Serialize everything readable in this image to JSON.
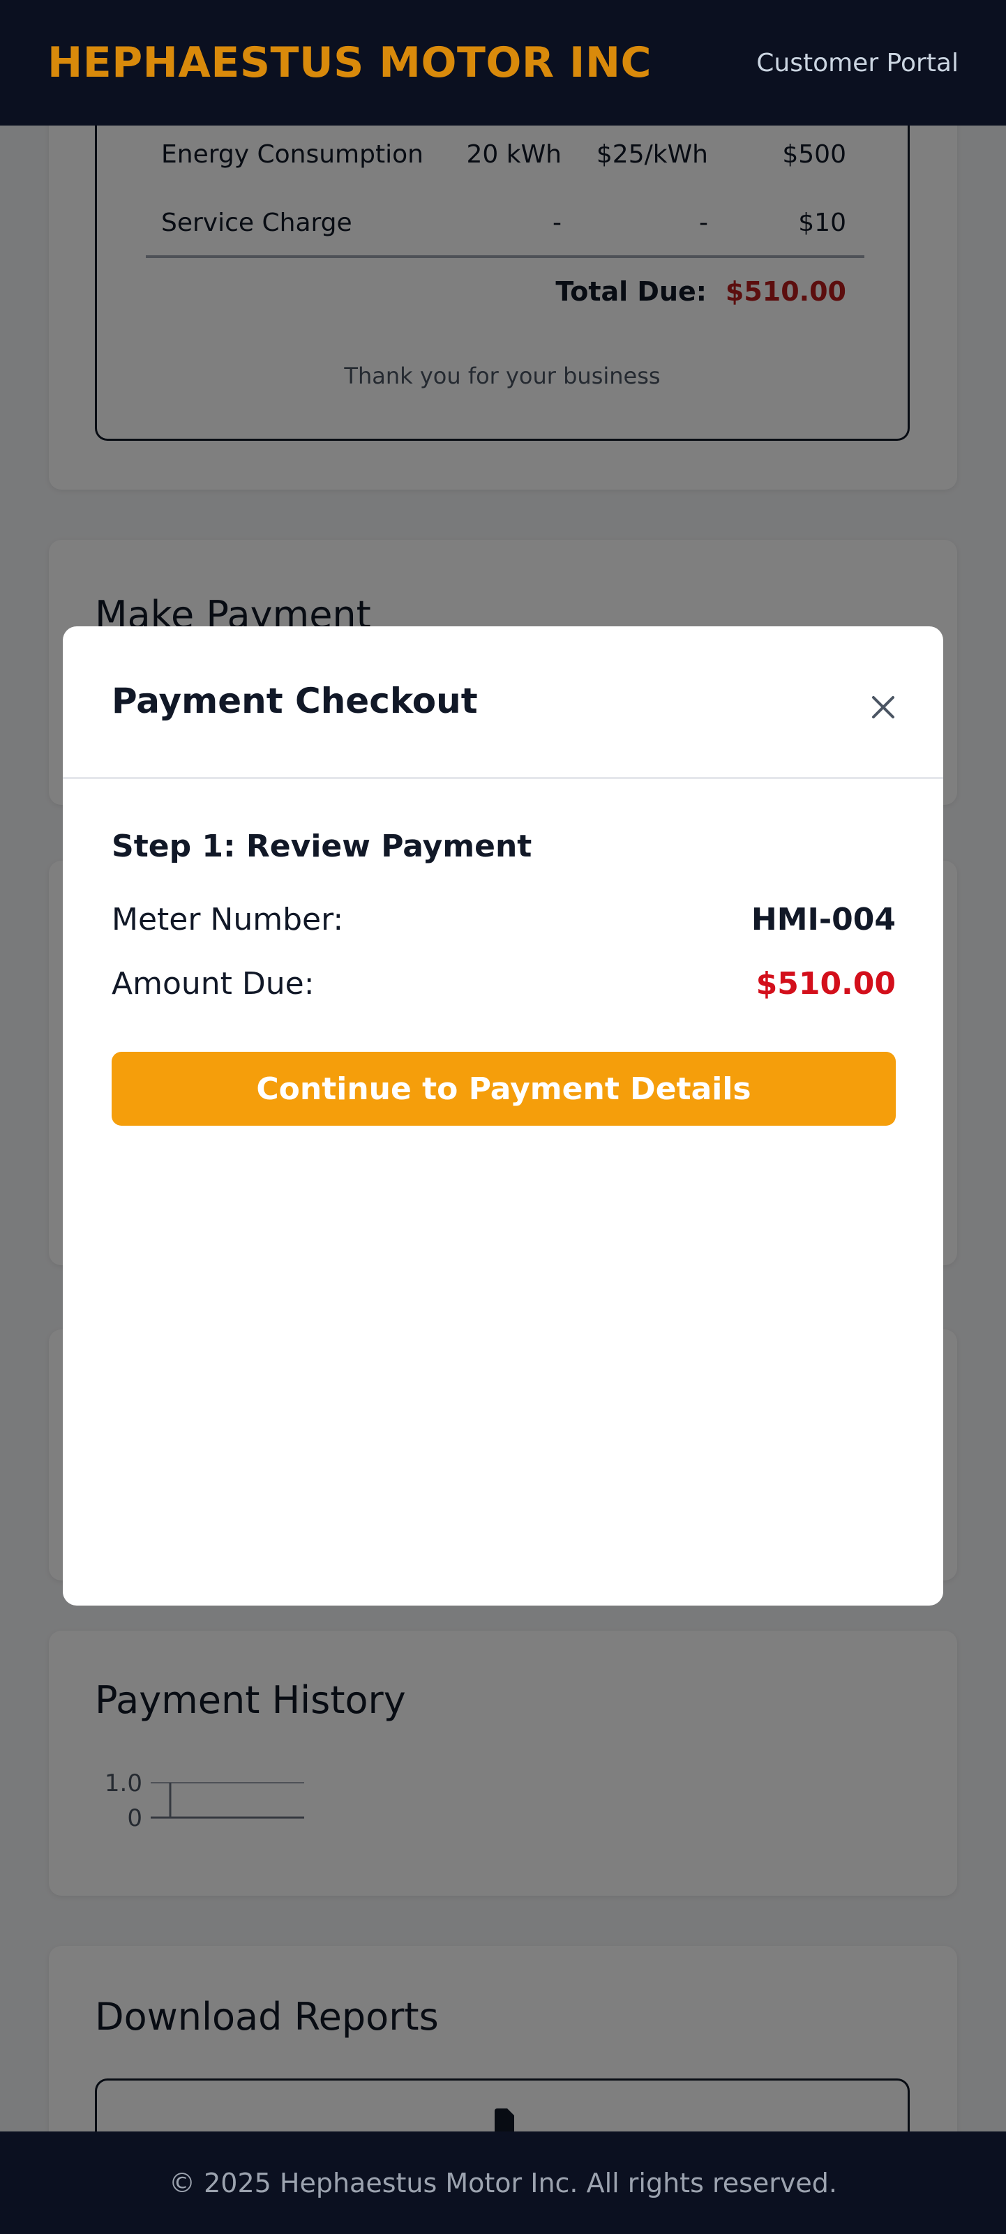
{
  "header": {
    "brand": "HEPHAESTUS MOTOR INC",
    "portal_label": "Customer Portal"
  },
  "invoice": {
    "rows": [
      {
        "description": "Energy Consumption",
        "quantity": "20 kWh",
        "rate": "$25/kWh",
        "amount": "$500"
      },
      {
        "description": "Service Charge",
        "quantity": "-",
        "rate": "-",
        "amount": "$10"
      }
    ],
    "total_label": "Total Due:",
    "total_value": "$510.00",
    "thanks": "Thank you for your business"
  },
  "make_payment": {
    "title": "Make Payment"
  },
  "payment_history": {
    "title": "Payment History",
    "chart_data": {
      "type": "line",
      "y_ticks": [
        "1.0",
        "0"
      ],
      "ylim": [
        0,
        1.0
      ],
      "series": []
    }
  },
  "download_reports": {
    "title": "Download Reports",
    "icon": "document-icon"
  },
  "modal": {
    "title": "Payment Checkout",
    "close_icon": "close-icon",
    "step_title": "Step 1: Review Payment",
    "meter_label": "Meter Number:",
    "meter_value": "HMI-004",
    "amount_label": "Amount Due:",
    "amount_value": "$510.00",
    "continue_label": "Continue to Payment Details"
  },
  "footer": {
    "copyright": "© 2025 Hephaestus Motor Inc. All rights reserved."
  },
  "colors": {
    "brand": "#d98a0b",
    "accent": "#f59e0b",
    "amount_due": "#d30f1b",
    "header_bg": "#0b1020"
  }
}
